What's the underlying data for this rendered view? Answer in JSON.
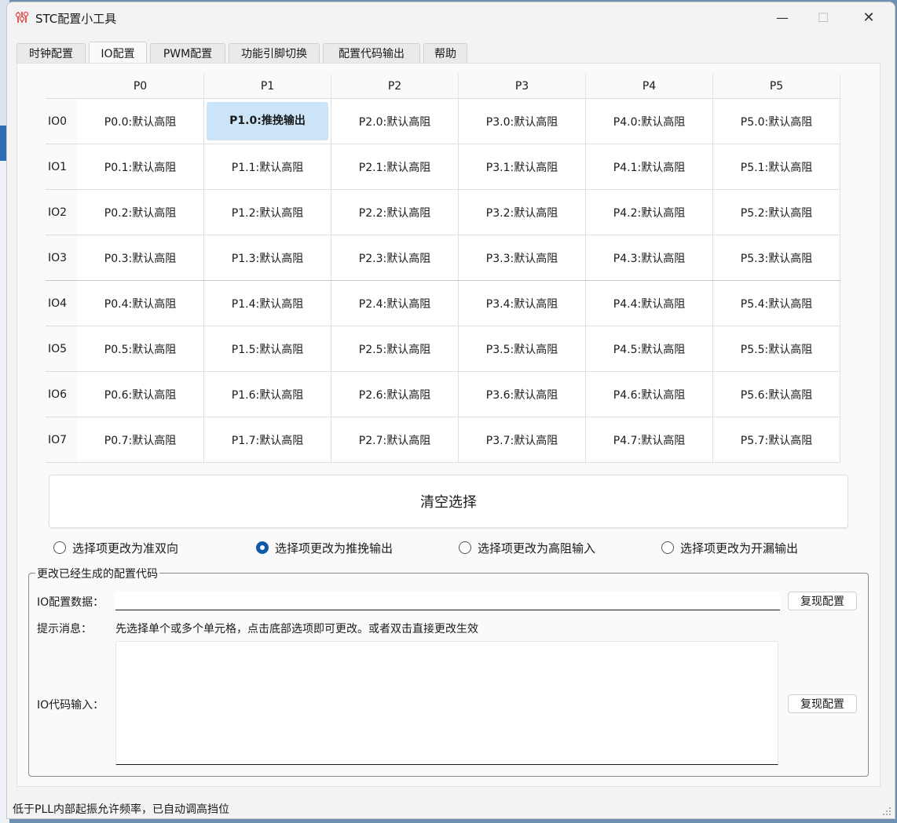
{
  "window": {
    "title": "STC配置小工具",
    "minimize_glyph": "—",
    "maximize_glyph": "☐",
    "close_glyph": "✕"
  },
  "tabs": [
    {
      "label": "时钟配置",
      "active": false
    },
    {
      "label": "IO配置",
      "active": true
    },
    {
      "label": "PWM配置",
      "active": false
    },
    {
      "label": "功能引脚切换",
      "active": false
    },
    {
      "label": "配置代码输出",
      "active": false
    },
    {
      "label": "帮助",
      "active": false
    }
  ],
  "table": {
    "columns": [
      "P0",
      "P1",
      "P2",
      "P3",
      "P4",
      "P5"
    ],
    "rows": [
      {
        "header": "IO0",
        "cells": [
          "P0.0:默认高阻",
          "P1.0:推挽输出",
          "P2.0:默认高阻",
          "P3.0:默认高阻",
          "P4.0:默认高阻",
          "P5.0:默认高阻"
        ]
      },
      {
        "header": "IO1",
        "cells": [
          "P0.1:默认高阻",
          "P1.1:默认高阻",
          "P2.1:默认高阻",
          "P3.1:默认高阻",
          "P4.1:默认高阻",
          "P5.1:默认高阻"
        ]
      },
      {
        "header": "IO2",
        "cells": [
          "P0.2:默认高阻",
          "P1.2:默认高阻",
          "P2.2:默认高阻",
          "P3.2:默认高阻",
          "P4.2:默认高阻",
          "P5.2:默认高阻"
        ]
      },
      {
        "header": "IO3",
        "cells": [
          "P0.3:默认高阻",
          "P1.3:默认高阻",
          "P2.3:默认高阻",
          "P3.3:默认高阻",
          "P4.3:默认高阻",
          "P5.3:默认高阻"
        ]
      },
      {
        "header": "IO4",
        "cells": [
          "P0.4:默认高阻",
          "P1.4:默认高阻",
          "P2.4:默认高阻",
          "P3.4:默认高阻",
          "P4.4:默认高阻",
          "P5.4:默认高阻"
        ]
      },
      {
        "header": "IO5",
        "cells": [
          "P0.5:默认高阻",
          "P1.5:默认高阻",
          "P2.5:默认高阻",
          "P3.5:默认高阻",
          "P4.5:默认高阻",
          "P5.5:默认高阻"
        ]
      },
      {
        "header": "IO6",
        "cells": [
          "P0.6:默认高阻",
          "P1.6:默认高阻",
          "P2.6:默认高阻",
          "P3.6:默认高阻",
          "P4.6:默认高阻",
          "P5.6:默认高阻"
        ]
      },
      {
        "header": "IO7",
        "cells": [
          "P0.7:默认高阻",
          "P1.7:默认高阻",
          "P2.7:默认高阻",
          "P3.7:默认高阻",
          "P4.7:默认高阻",
          "P5.7:默认高阻"
        ]
      }
    ],
    "selected_cell": "P1.0"
  },
  "clear_button": "清空选择",
  "radios": [
    {
      "label": "选择项更改为准双向",
      "checked": false
    },
    {
      "label": "选择项更改为推挽输出",
      "checked": true
    },
    {
      "label": "选择项更改为高阻输入",
      "checked": false
    },
    {
      "label": "选择项更改为开漏输出",
      "checked": false
    }
  ],
  "group": {
    "title": "更改已经生成的配置代码",
    "io_data_label": "IO配置数据：",
    "io_data_value": "",
    "restore_button_1": "复现配置",
    "hint_label": "提示消息：",
    "hint_text": "先选择单个或多个单元格，点击底部选项即可更改。或者双击直接更改生效",
    "io_code_label": "IO代码输入：",
    "io_code_value": "",
    "restore_button_2": "复现配置"
  },
  "status": {
    "text": "低于PLL内部起振允许频率，已自动调高挡位"
  },
  "colors": {
    "accent": "#0f5aa8",
    "selection": "#cce4f7"
  }
}
